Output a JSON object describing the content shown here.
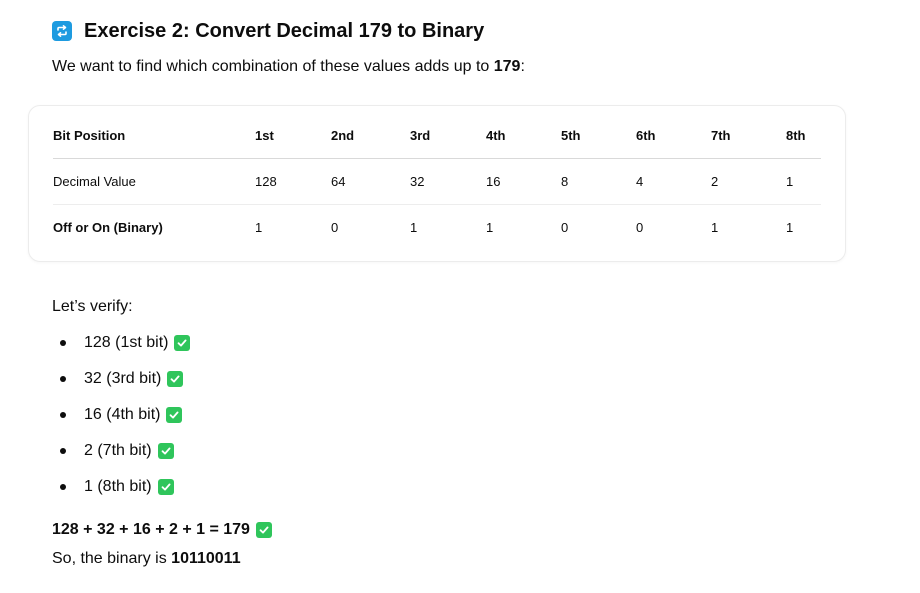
{
  "heading": {
    "icon": "repeat-icon",
    "title": "Exercise 2: Convert Decimal 179 to Binary"
  },
  "intro": {
    "text": "We want to find which combination of these values adds up to ",
    "target": "179",
    "suffix": ":"
  },
  "table": {
    "headers": [
      "Bit Position",
      "1st",
      "2nd",
      "3rd",
      "4th",
      "5th",
      "6th",
      "7th",
      "8th"
    ],
    "rows": [
      {
        "label": "Decimal Value",
        "values": [
          "128",
          "64",
          "32",
          "16",
          "8",
          "4",
          "2",
          "1"
        ]
      },
      {
        "label": "Off or On (Binary)",
        "values": [
          "1",
          "0",
          "1",
          "1",
          "0",
          "0",
          "1",
          "1"
        ]
      }
    ]
  },
  "verify": {
    "title": "Let’s verify:",
    "items": [
      "128 (1st bit)",
      "32 (3rd bit)",
      "16 (4th bit)",
      "2 (7th bit)",
      "1 (8th bit)"
    ]
  },
  "sum": "128 + 32 + 16 + 2 + 1 = 179",
  "conclusion": {
    "text": "So, the binary is ",
    "binary": "10110011"
  },
  "colors": {
    "icon_blue": "#1e9be0",
    "check_green": "#2fc55b"
  }
}
